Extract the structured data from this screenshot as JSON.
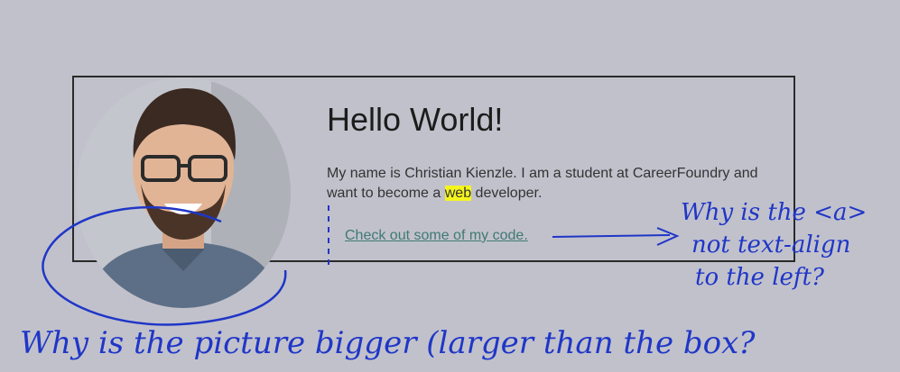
{
  "profile": {
    "heading": "Hello World!",
    "bio_before": "My name is Christian Kienzle. I am a student at CareerFoundry and want to become a ",
    "bio_highlight": "web",
    "bio_after": " developer.",
    "link_text": "Check out some of my code."
  },
  "annotations": {
    "note_right_line1": "Why is the <a>",
    "note_right_line2": "not text-align",
    "note_right_line3": "to the left?",
    "note_bottom": "Why is the picture bigger (larger than the box?"
  },
  "colors": {
    "page_background": "#c1c1cc",
    "highlight": "#f5f51e",
    "link": "#3f7a72",
    "annotation_ink": "#1f36c7"
  }
}
